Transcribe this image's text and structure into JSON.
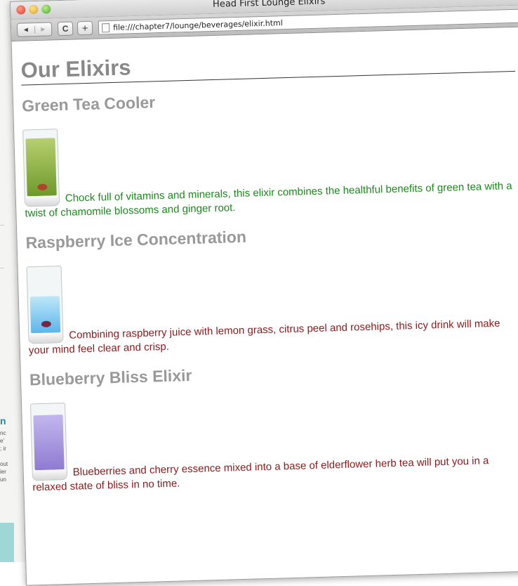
{
  "window": {
    "title": "Head First Lounge Elixirs",
    "url": "file:///chapter7/lounge/beverages/elixir.html"
  },
  "toolbar": {
    "back_icon": "◄",
    "forward_icon": "►",
    "reload_icon": "C",
    "add_icon": "+"
  },
  "page": {
    "heading": "Our Elixirs",
    "elixirs": [
      {
        "name": "Green Tea Cooler",
        "description": "Chock full of vitamins and minerals, this elixir combines the healthful benefits of green tea with a twist of chamomile blossoms and ginger root.",
        "liquid_color": "#7fa832"
      },
      {
        "name": "Raspberry Ice Concentration",
        "description": "Combining raspberry juice with lemon grass, citrus peel and rosehips, this icy drink will make your mind feel clear and crisp.",
        "liquid_color": "#6ec2ee"
      },
      {
        "name": "Blueberry Bliss Elixir",
        "description": "Blueberries and cherry essence mixed into a base of elderflower herb tea will put you in a relaxed state of bliss in no time.",
        "liquid_color": "#9c8ad8"
      }
    ]
  },
  "colors": {
    "heading": "#888888",
    "green_text": "#1a8a1a",
    "red_text": "#8b1a1a"
  }
}
